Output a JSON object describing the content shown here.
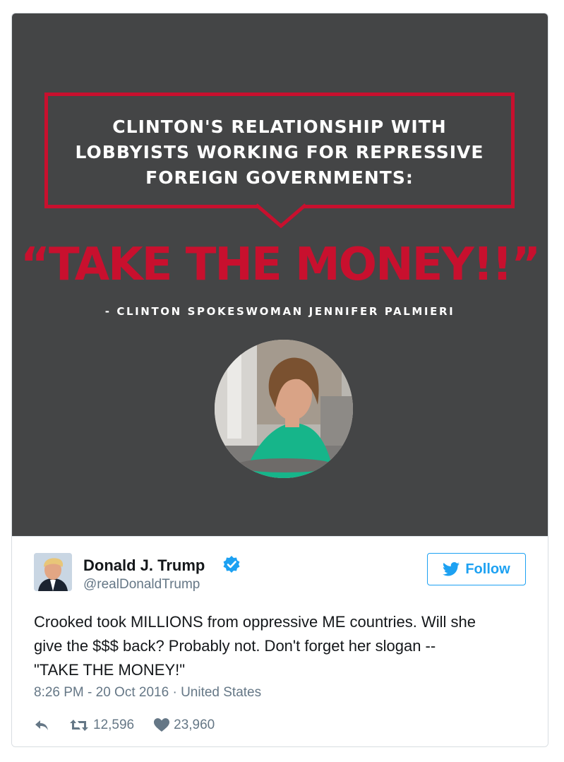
{
  "media": {
    "quote_lines": [
      "CLINTON'S RELATIONSHIP WITH",
      "LOBBYISTS WORKING FOR REPRESSIVE",
      "FOREIGN GOVERNMENTS:"
    ],
    "headline": "“TAKE THE MONEY!!”",
    "attribution": "- CLINTON SPOKESWOMAN JENNIFER PALMIERI",
    "accent_color": "#c8102e",
    "background_color": "#444546"
  },
  "tweet": {
    "display_name": "Donald J. Trump",
    "handle": "@realDonaldTrump",
    "follow_label": "Follow",
    "text_lines": [
      "Crooked took MILLIONS from oppressive ME countries. Will she",
      "give the $$$ back? Probably not. Don't forget her slogan --",
      "\"TAKE THE MONEY!\""
    ],
    "time": "8:26 PM - 20 Oct 2016",
    "separator": "·",
    "location": "United States",
    "retweets": "12,596",
    "likes": "23,960",
    "brand_color": "#1da1f2"
  }
}
